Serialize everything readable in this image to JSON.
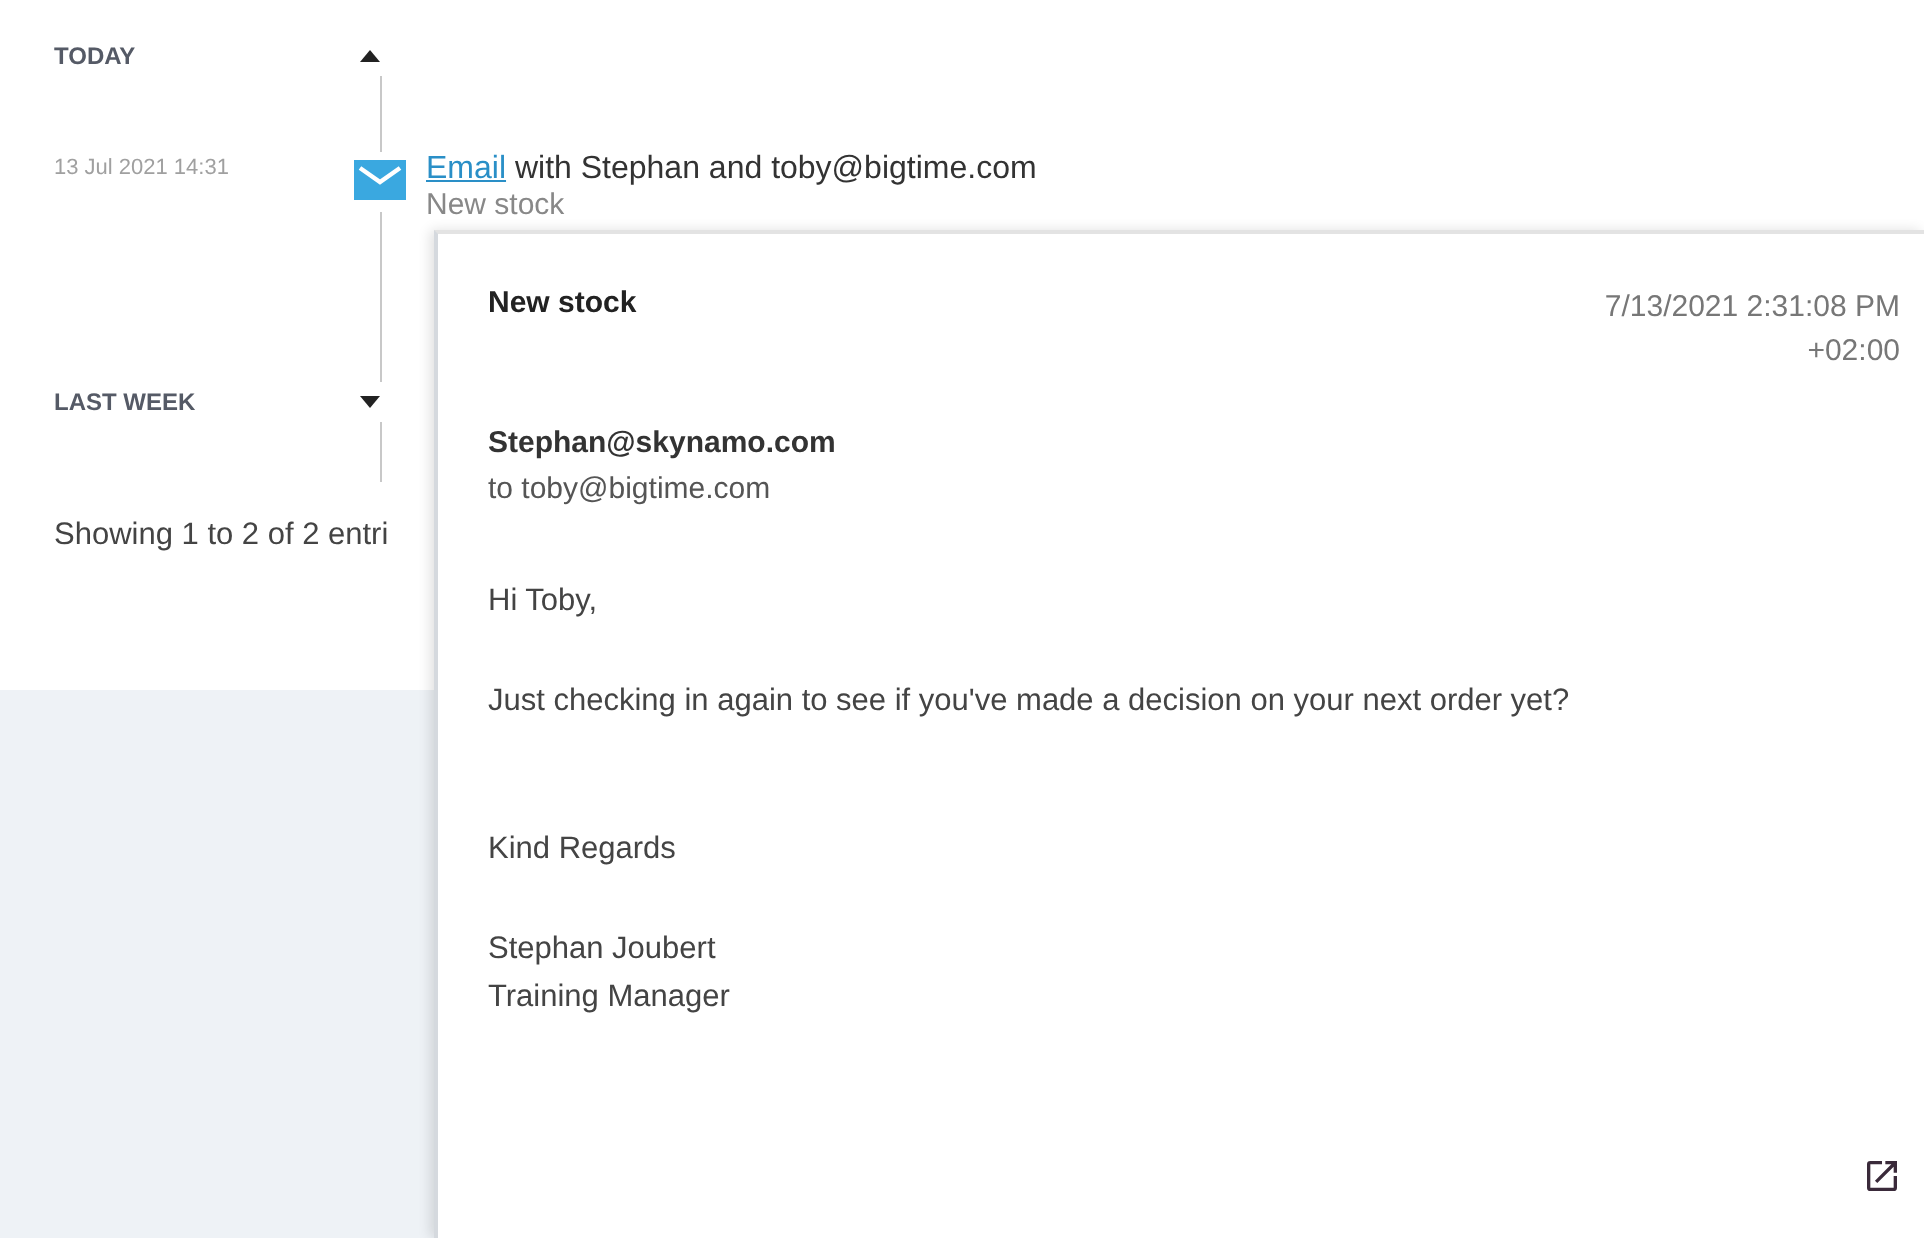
{
  "timeline": {
    "groups": [
      {
        "label": "TODAY",
        "expanded": true,
        "entries": [
          {
            "kind": "email",
            "date": "13 Jul 2021 14:31",
            "link": "Email",
            "summary": "with Stephan and toby@bigtime.com",
            "subject": "New stock"
          }
        ]
      },
      {
        "label": "LAST WEEK",
        "expanded": false
      }
    ],
    "footer": "Showing 1 to 2 of 2 entri"
  },
  "preview": {
    "subject": "New stock",
    "date": "7/13/2021 2:31:08 PM",
    "timezone": "+02:00",
    "from": "Stephan@skynamo.com",
    "to": "to toby@bigtime.com",
    "body": [
      [
        "Hi Toby,"
      ],
      [
        "Just checking in again to see if you've made a decision on your next order yet?"
      ],
      [
        "Kind Regards"
      ],
      [
        "Stephan Joubert",
        "Training Manager"
      ]
    ]
  }
}
